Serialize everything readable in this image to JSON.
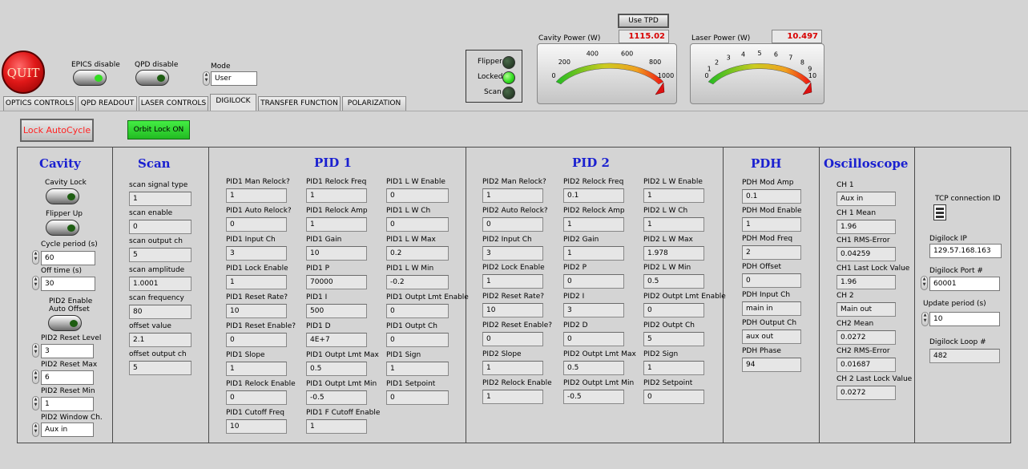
{
  "top": {
    "quit_label": "QUIT",
    "epics_label": "EPICS disable",
    "qpd_label": "QPD disable",
    "mode_label": "Mode",
    "mode_value": "User",
    "use_tpd_label": "Use TPD"
  },
  "status": {
    "flipper": "Flipper",
    "locked": "Locked",
    "scan": "Scan"
  },
  "cavity_gauge": {
    "label": "Cavity Power (W)",
    "value": "1115.02",
    "ticks": [
      "0",
      "200",
      "400",
      "600",
      "800",
      "1000"
    ],
    "level": 1.0
  },
  "laser_gauge": {
    "label": "Laser Power (W)",
    "value": "10.497",
    "ticks": [
      "0",
      "1",
      "2",
      "3",
      "4",
      "5",
      "6",
      "7",
      "8",
      "9",
      "10"
    ],
    "level": 1.0
  },
  "tabs": [
    "OPTICS CONTROLS",
    "QPD READOUT",
    "LASER CONTROLS",
    "DIGILOCK",
    "TRANSFER FUNCTION",
    "POLARIZATION"
  ],
  "buttons": {
    "lock_autocycle": "Lock AutoCycle",
    "orbit_lock": "Orbit Lock ON"
  },
  "colors": {
    "title_blue": "#1a20d0",
    "lock_red": "#ff2222",
    "led_green": "#33dd22",
    "orbit_green": "#22cc22",
    "quit_red": "#e01818",
    "digit_red": "#d80000"
  },
  "cavity": {
    "title": "Cavity",
    "cavity_lock": "Cavity Lock",
    "flipper_up": "Flipper Up",
    "cycle_period_label": "Cycle period (s)",
    "cycle_period": "60",
    "off_time_label": "Off time (s)",
    "off_time": "30",
    "pid2_enable_label": "PID2 Enable",
    "auto_offset_label": "Auto Offset",
    "reset_level_label": "PID2 Reset Level",
    "reset_level": "3",
    "reset_max_label": "PID2 Reset Max",
    "reset_max": "6",
    "reset_min_label": "PID2 Reset Min",
    "reset_min": "1",
    "window_label": "PID2 Window Ch.",
    "window": "Aux in"
  },
  "scan": {
    "title": "Scan",
    "fields": [
      {
        "label": "scan signal type",
        "value": "1"
      },
      {
        "label": "scan enable",
        "value": "0"
      },
      {
        "label": "scan output ch",
        "value": "5"
      },
      {
        "label": "scan amplitude",
        "value": "1.0001"
      },
      {
        "label": "scan frequency",
        "value": "80"
      },
      {
        "label": "offset value",
        "value": "2.1"
      },
      {
        "label": "offset output ch",
        "value": "5"
      }
    ]
  },
  "pid1": {
    "title": "PID 1",
    "col1": [
      {
        "label": "PID1 Man Relock?",
        "value": "1"
      },
      {
        "label": "PID1 Auto Relock?",
        "value": "0"
      },
      {
        "label": "PID1 Input Ch",
        "value": "3"
      },
      {
        "label": "PID1 Lock Enable",
        "value": "1"
      },
      {
        "label": "PID1 Reset Rate?",
        "value": "10"
      },
      {
        "label": "PID1 Reset Enable?",
        "value": "0"
      },
      {
        "label": "PID1 Slope",
        "value": "1"
      },
      {
        "label": "PID1 Relock Enable",
        "value": "0"
      },
      {
        "label": "PID1 Cutoff Freq",
        "value": "10"
      }
    ],
    "col2": [
      {
        "label": "PID1 Relock Freq",
        "value": "1"
      },
      {
        "label": "PID1 Relock Amp",
        "value": "1"
      },
      {
        "label": "PID1 Gain",
        "value": "10"
      },
      {
        "label": "PID1 P",
        "value": "70000"
      },
      {
        "label": "PID1 I",
        "value": "500"
      },
      {
        "label": "PID1 D",
        "value": "4E+7"
      },
      {
        "label": "PID1 Outpt Lmt Max",
        "value": "0.5"
      },
      {
        "label": "PID1 Outpt Lmt Min",
        "value": "-0.5"
      },
      {
        "label": "PID1 F Cutoff Enable",
        "value": "1"
      }
    ],
    "col3": [
      {
        "label": "PID1 L W Enable",
        "value": "0"
      },
      {
        "label": "PID1 L W Ch",
        "value": "0"
      },
      {
        "label": "PID1 L W Max",
        "value": "0.2"
      },
      {
        "label": "PID1 L W Min",
        "value": "-0.2"
      },
      {
        "label": "PID1 Outpt Lmt Enable",
        "value": "0"
      },
      {
        "label": "PID1 Outpt Ch",
        "value": "0"
      },
      {
        "label": "PID1 Sign",
        "value": "1"
      },
      {
        "label": "PID1 Setpoint",
        "value": "0"
      }
    ]
  },
  "pid2": {
    "title": "PID 2",
    "col1": [
      {
        "label": "PID2 Man Relock?",
        "value": "1"
      },
      {
        "label": "PID2 Auto Relock?",
        "value": "0"
      },
      {
        "label": "PID2 Input Ch",
        "value": "3"
      },
      {
        "label": "PID2 Lock Enable",
        "value": "1"
      },
      {
        "label": "PID2 Reset Rate?",
        "value": "10"
      },
      {
        "label": "PID2 Reset Enable?",
        "value": "0"
      },
      {
        "label": "PID2 Slope",
        "value": "1"
      },
      {
        "label": "PID2 Relock Enable",
        "value": "1"
      }
    ],
    "col2": [
      {
        "label": "PID2 Relock Freq",
        "value": "0.1"
      },
      {
        "label": "PID2 Relock Amp",
        "value": "1"
      },
      {
        "label": "PID2 Gain",
        "value": "1"
      },
      {
        "label": "PID2 P",
        "value": "0"
      },
      {
        "label": "PID2 I",
        "value": "3"
      },
      {
        "label": "PID2 D",
        "value": "0"
      },
      {
        "label": "PID2 Outpt Lmt Max",
        "value": "0.5"
      },
      {
        "label": "PID2 Outpt Lmt Min",
        "value": "-0.5"
      }
    ],
    "col3": [
      {
        "label": "PID2 L W Enable",
        "value": "1"
      },
      {
        "label": "PID2 L W Ch",
        "value": "1"
      },
      {
        "label": "PID2 L W Max",
        "value": "1.978"
      },
      {
        "label": "PID2 L W Min",
        "value": "0.5"
      },
      {
        "label": "PID2 Outpt Lmt Enable",
        "value": "0"
      },
      {
        "label": "PID2 Outpt Ch",
        "value": "5"
      },
      {
        "label": "PID2 Sign",
        "value": "1"
      },
      {
        "label": "PID2 Setpoint",
        "value": "0"
      }
    ]
  },
  "pdh": {
    "title": "PDH",
    "fields": [
      {
        "label": "PDH Mod Amp",
        "value": "0.1"
      },
      {
        "label": "PDH Mod Enable",
        "value": "1"
      },
      {
        "label": "PDH Mod Freq",
        "value": "2"
      },
      {
        "label": "PDH Offset",
        "value": "0"
      },
      {
        "label": "PDH Input Ch",
        "value": "main in"
      },
      {
        "label": "PDH Output Ch",
        "value": "aux out"
      },
      {
        "label": "PDH Phase",
        "value": "94"
      }
    ]
  },
  "osc": {
    "title": "Oscilloscope",
    "fields": [
      {
        "label": "CH 1",
        "value": "Aux in"
      },
      {
        "label": "CH 1 Mean",
        "value": "1.96"
      },
      {
        "label": "CH1 RMS-Error",
        "value": "0.04259"
      },
      {
        "label": "CH1 Last Lock Value",
        "value": "1.96"
      },
      {
        "label": "CH 2",
        "value": "Main out"
      },
      {
        "label": "CH2 Mean",
        "value": "0.0272"
      },
      {
        "label": "CH2 RMS-Error",
        "value": "0.01687"
      },
      {
        "label": "CH 2 Last Lock Value",
        "value": "0.0272"
      }
    ]
  },
  "tcp": {
    "conn_label": "TCP connection ID",
    "ip_label": "Digilock IP",
    "ip": "129.57.168.163",
    "port_label": "Digilock Port #",
    "port": "60001",
    "update_label": "Update period (s)",
    "update": "10",
    "loop_label": "Digilock Loop #",
    "loop": "482"
  }
}
